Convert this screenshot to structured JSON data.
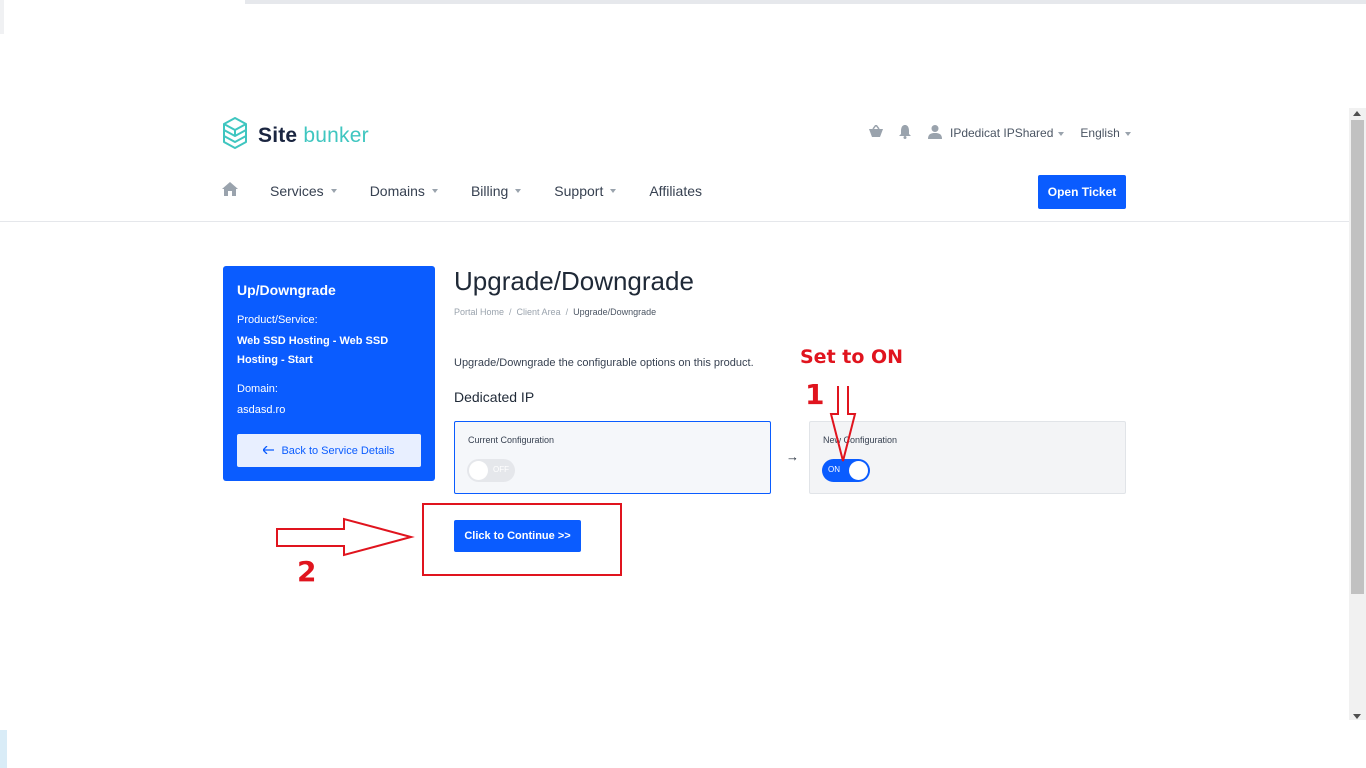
{
  "brand": {
    "site": "Site",
    "bunker": "bunker",
    "logo_icon": "cube-stack-icon",
    "accent": "#0a5cff",
    "logo_color": "#3fc6c0"
  },
  "topbar": {
    "cart_icon": "basket-icon",
    "bell_icon": "bell-icon",
    "user_icon": "user-icon",
    "user_name": "IPdedicat IPShared",
    "language": "English"
  },
  "nav": {
    "home_icon": "home-icon",
    "items": [
      {
        "label": "Services",
        "dropdown": true
      },
      {
        "label": "Domains",
        "dropdown": true
      },
      {
        "label": "Billing",
        "dropdown": true
      },
      {
        "label": "Support",
        "dropdown": true
      },
      {
        "label": "Affiliates",
        "dropdown": false
      }
    ],
    "open_ticket": "Open Ticket"
  },
  "sidebar": {
    "title": "Up/Downgrade",
    "product_label": "Product/Service:",
    "product_value": "Web SSD Hosting - Web SSD Hosting - Start",
    "domain_label": "Domain:",
    "domain_value": "asdasd.ro",
    "back_label": "Back to Service Details",
    "back_icon": "arrow-left-icon"
  },
  "main": {
    "title": "Upgrade/Downgrade",
    "breadcrumb": [
      "Portal Home",
      "Client Area",
      "Upgrade/Downgrade"
    ],
    "description": "Upgrade/Downgrade the configurable options on this product.",
    "option_name": "Dedicated IP",
    "current": {
      "label": "Current Configuration",
      "state": "OFF"
    },
    "new": {
      "label": "New Configuration",
      "state": "ON"
    },
    "arrow": "→",
    "continue_label": "Click to Continue >>"
  },
  "annotations": {
    "set_on": "Set to ON",
    "step1": "1",
    "step2": "2",
    "color": "#e0141e"
  }
}
